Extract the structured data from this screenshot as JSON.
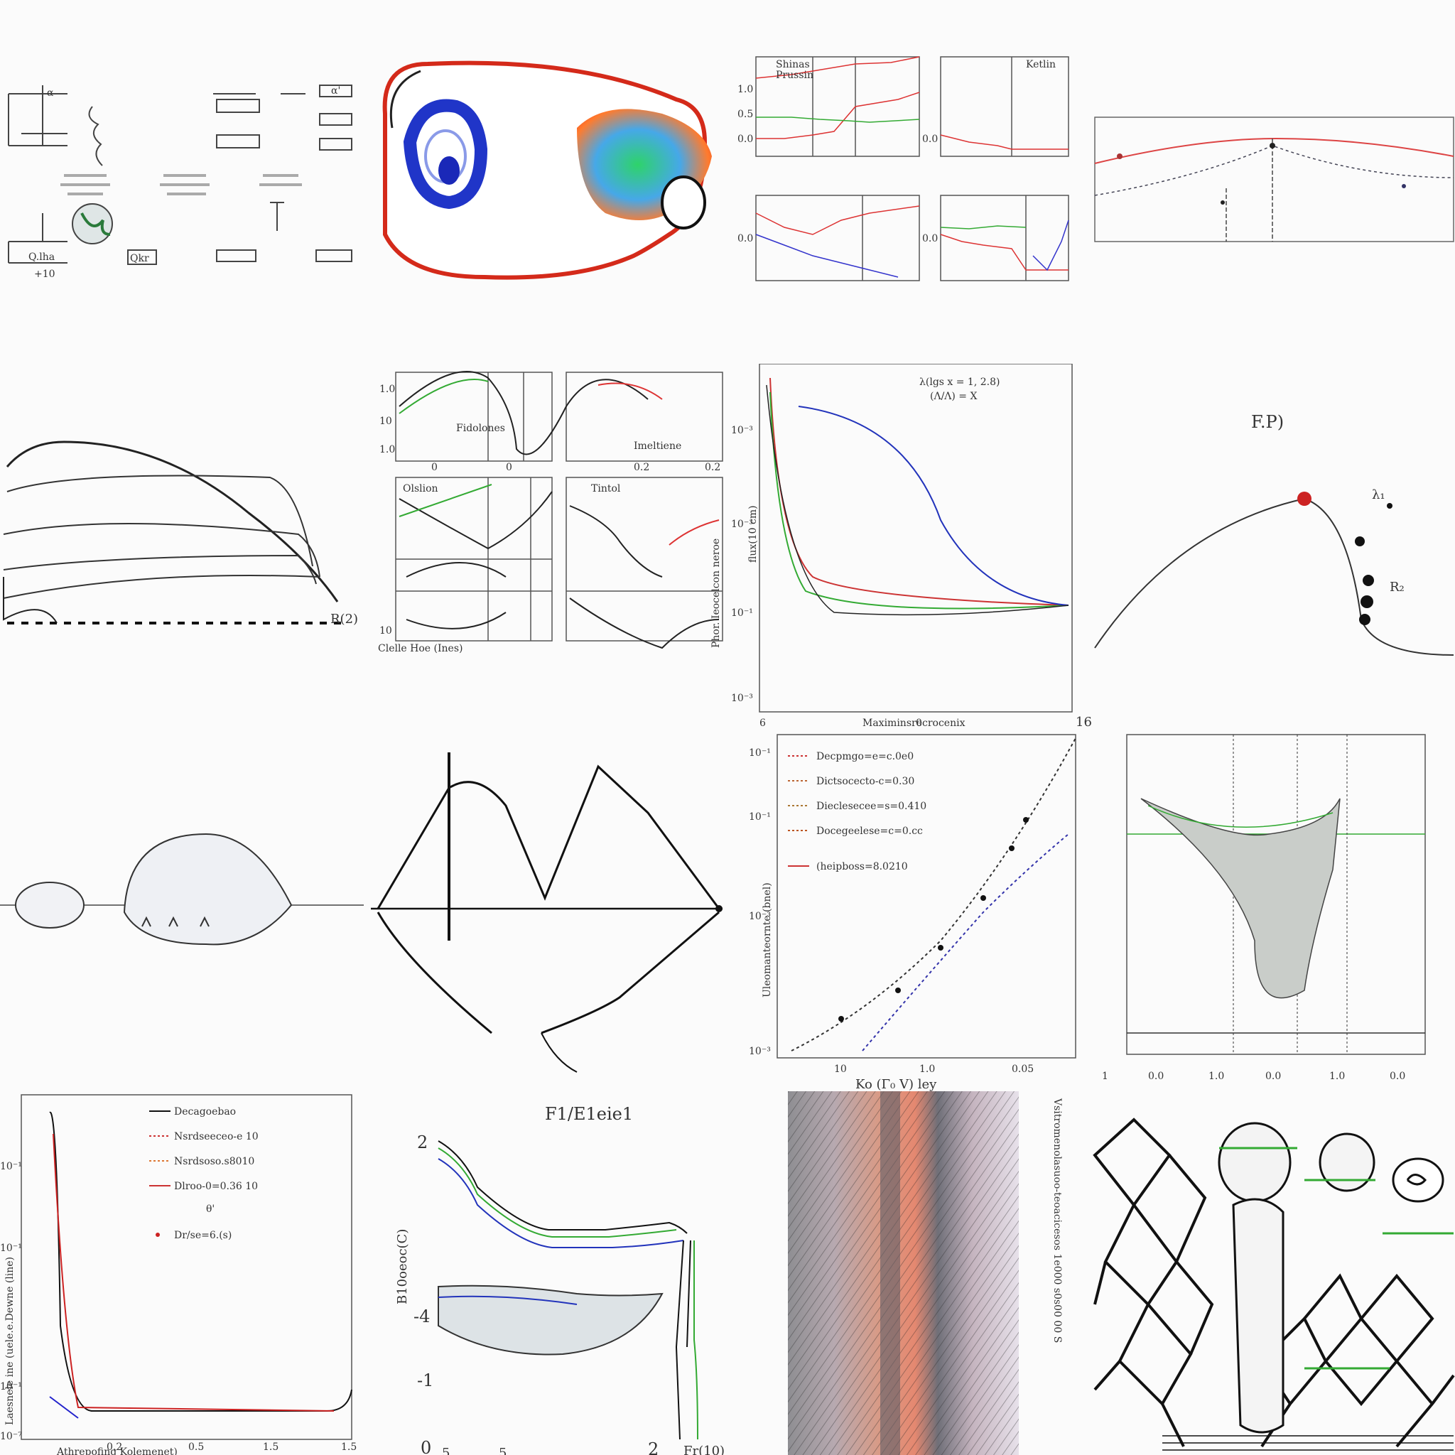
{
  "tiles": [
    {
      "name": "schematic-blocks",
      "labels": [
        "α",
        "α'",
        "Q.lha",
        "Qkr",
        "+10"
      ]
    },
    {
      "name": "colored-shape"
    },
    {
      "name": "multi-panel-traces",
      "panel_labels": [
        "Shinas",
        "Prussin",
        "Ketlin"
      ],
      "axis": [
        "0.0",
        "0.5",
        "1.0",
        "0.0",
        "0.0",
        "0.0"
      ]
    },
    {
      "name": "single-curve-panel"
    },
    {
      "name": "outline-sketch",
      "label": "R(2)"
    },
    {
      "name": "quad-curve-panels",
      "ticks": [
        "1.0",
        "10",
        "1.0",
        "0",
        "0",
        "0.2",
        "0.2",
        "10"
      ],
      "labels": [
        "Fidolones",
        "Imeltiene",
        "Olslion",
        "Tintol",
        "Clelle Hoe (Ines)",
        "Phor. Ieocelcon neroe"
      ]
    },
    {
      "name": "decay-log-plot",
      "annotation": [
        "λ(lgs x = 1, 2.8)",
        "(Λ/Λ) = X"
      ],
      "yticks": [
        "10⁻³",
        "10⁻³",
        "10⁻¹",
        "10⁻³"
      ],
      "xticks": [
        "6",
        "0",
        "16"
      ],
      "ylabel": "flux(10 cm)",
      "xlabel": "Maximinsrecrocenix"
    },
    {
      "name": "arc-with-points",
      "title": "F.P)",
      "labels": [
        "λ₁",
        "R₂"
      ]
    },
    {
      "name": "blob-outline"
    },
    {
      "name": "zigzag-lines"
    },
    {
      "name": "log-log-legend-plot",
      "legend": [
        "Decpmgo=e=c.0e0",
        "Dictsocecto-c=0.30",
        "Dieclesecee=s=0.410",
        "Docegeelese=c=0.cc",
        "(heipboss=8.0210"
      ],
      "yticks": [
        "10⁻¹",
        "10⁻¹",
        "10⁻³",
        "10⁻³"
      ],
      "xticks": [
        "10",
        "1.0",
        "0.05"
      ],
      "ylabel": "Uleomanteornte (bnel)",
      "xlabel": "Ko  (Γ₀ V) ley"
    },
    {
      "name": "dense-vertical-plot",
      "xticks": [
        "1",
        "0.0",
        "1.0",
        "0.0",
        "1.0",
        "0.0"
      ]
    },
    {
      "name": "log-decay-legend-plot",
      "legend": [
        "Decagoebao",
        "Nsrdseeceo-e 10",
        "Nsrdsoso.s8010",
        "Dlroo-0=0.36 10",
        "θ'",
        "Dr/se=6.(s)"
      ],
      "yticks": [
        "10⁻¹",
        "10⁻¹",
        "10⁻¹",
        "10⁻⁷"
      ],
      "xticks": [
        "0.2",
        "0.5",
        "1.5",
        "1.5"
      ],
      "ylabel": "Laesnele ine (uele.e.Dewne (line)",
      "xlabel": "Athrepofing Kolemenet)"
    },
    {
      "name": "band-curves-plot",
      "title": "F1/E1eie1",
      "yticks": [
        "2",
        "-4",
        "-1",
        "0"
      ],
      "xticks": [
        "5",
        "5",
        "2"
      ],
      "ylabel": "B10oeoc(C)",
      "xlabel": "Fr(10)"
    },
    {
      "name": "textured-image",
      "side_text": "Vsitromenolasuoo-teoacicesos 1e000 s0s00 00 S"
    },
    {
      "name": "network-sketch"
    }
  ]
}
